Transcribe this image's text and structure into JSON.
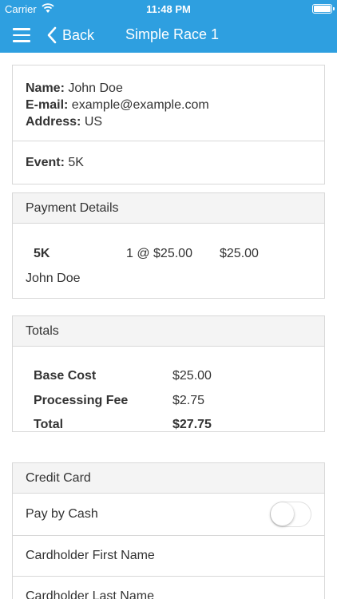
{
  "status_bar": {
    "carrier": "Carrier",
    "time": "11:48 PM"
  },
  "nav": {
    "back_label": "Back",
    "title": "Simple Race 1"
  },
  "registrant": {
    "name_label": "Name:",
    "name": "John Doe",
    "email_label": "E-mail:",
    "email": "example@example.com",
    "address_label": "Address:",
    "address": "US",
    "event_label": "Event:",
    "event": "5K"
  },
  "payment": {
    "header": "Payment Details",
    "items": [
      {
        "name": "5K",
        "quantity": "1 @ $25.00",
        "amount": "$25.00",
        "person": "John Doe"
      }
    ]
  },
  "totals": {
    "header": "Totals",
    "rows": [
      {
        "label": "Base Cost",
        "value": "$25.00"
      },
      {
        "label": "Processing Fee",
        "value": "$2.75"
      },
      {
        "label": "Total",
        "value": "$27.75"
      }
    ]
  },
  "credit_card": {
    "header": "Credit Card",
    "pay_by_cash_label": "Pay by Cash",
    "pay_by_cash_on": false,
    "first_name_label": "Cardholder First Name",
    "last_name_label": "Cardholder Last Name"
  },
  "colors": {
    "primary": "#2e9fe0",
    "header_bg": "#f4f4f4",
    "border": "#d8d8d8"
  }
}
